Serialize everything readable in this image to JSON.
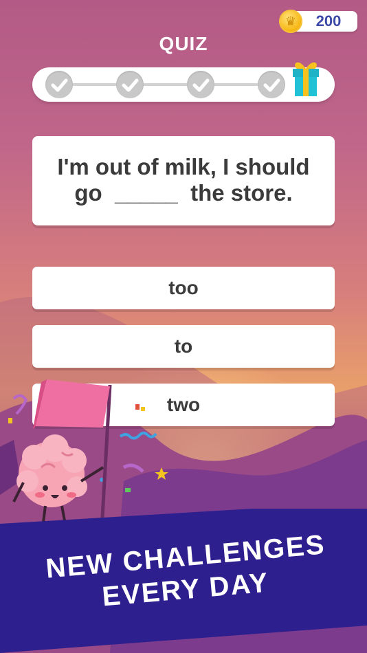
{
  "header": {
    "coins": "200",
    "coin_icon": "crown-coin-icon",
    "title": "QUIZ"
  },
  "progress": {
    "completed_steps": 4,
    "total_steps": 4,
    "step_icon": "checkmark-icon",
    "reward_icon": "gift-box-icon",
    "colors": {
      "step": "#c8c8c8",
      "track": "#d2d2d2"
    }
  },
  "question": {
    "line1": "I'm out of milk, I should",
    "line2": "go  _____  the store."
  },
  "answers": [
    {
      "label": "too"
    },
    {
      "label": "to"
    },
    {
      "label": "two"
    }
  ],
  "banner": {
    "line1": "NEW CHALLENGES",
    "line2": "EVERY DAY",
    "color": "#2e1f8f"
  },
  "mascot": {
    "icon": "brain-mascot-icon",
    "flag_icon": "pink-flag-icon"
  }
}
